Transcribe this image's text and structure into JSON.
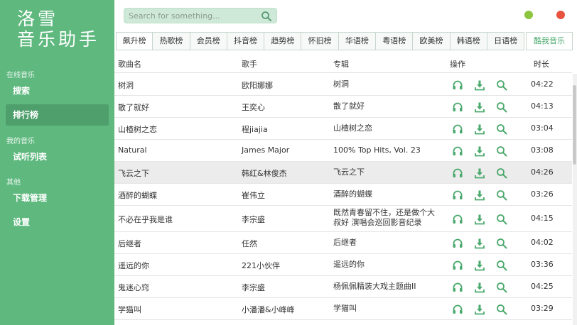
{
  "app": {
    "title_line1": "洛雪",
    "title_line2": "音乐助手"
  },
  "sidebar": {
    "sections": [
      {
        "label": "在线音乐",
        "items": [
          {
            "label": "搜索"
          },
          {
            "label": "排行榜",
            "active": true
          }
        ]
      },
      {
        "label": "我的音乐",
        "items": [
          {
            "label": "试听列表"
          }
        ]
      },
      {
        "label": "其他",
        "items": [
          {
            "label": "下载管理"
          },
          {
            "label": "设置"
          }
        ]
      }
    ]
  },
  "search": {
    "placeholder": "Search for something..."
  },
  "tabs": [
    "飙升榜",
    "热歌榜",
    "会员榜",
    "抖音榜",
    "趋势榜",
    "怀旧榜",
    "华语榜",
    "粤语榜",
    "欧美榜",
    "韩语榜",
    "日语榜"
  ],
  "active_tab": 0,
  "source_button": "酷我音乐",
  "table": {
    "headers": {
      "name": "歌曲名",
      "artist": "歌手",
      "album": "专辑",
      "actions": "操作",
      "duration": "时长"
    },
    "rows": [
      {
        "name": "树洞",
        "artist": "欧阳娜娜",
        "album": "树洞",
        "duration": "04:22"
      },
      {
        "name": "散了就好",
        "artist": "王奕心",
        "album": "散了就好",
        "duration": "04:13"
      },
      {
        "name": "山楂树之恋",
        "artist": "程jiajia",
        "album": "山楂树之恋",
        "duration": "03:04"
      },
      {
        "name": "Natural",
        "artist": "James Major",
        "album": "100% Top Hits, Vol. 23",
        "duration": "03:08"
      },
      {
        "name": "飞云之下",
        "artist": "韩红&林俊杰",
        "album": "飞云之下",
        "duration": "04:26",
        "highlight": true
      },
      {
        "name": "酒醉的蝴蝶",
        "artist": "崔伟立",
        "album": "酒醉的蝴蝶",
        "duration": "03:26"
      },
      {
        "name": "不必在乎我是谁",
        "artist": "李宗盛",
        "album": "既然青春留不住，还是做个大叔好 演唱会巡回影音纪录",
        "duration": "04:15",
        "tall": true
      },
      {
        "name": "后继者",
        "artist": "任然",
        "album": "后继者",
        "duration": "04:02"
      },
      {
        "name": "遥远的你",
        "artist": "221小伙伴",
        "album": "遥远的你",
        "duration": "03:36"
      },
      {
        "name": "鬼迷心窍",
        "artist": "李宗盛",
        "album": "杨佩佩精装大戏主题曲II",
        "duration": "04:25"
      },
      {
        "name": "学猫叫",
        "artist": "小潘潘&小峰峰",
        "album": "学猫叫",
        "duration": "03:29"
      }
    ]
  },
  "colors": {
    "accent": "#4aa96c",
    "sidebar": "#5fb97f",
    "sidebar_active": "#4e9f6c",
    "min_dot": "#8cc63f",
    "close_dot": "#e8533f"
  },
  "icons": {
    "listen": "headphones-icon",
    "download": "download-icon",
    "search": "search-icon"
  }
}
